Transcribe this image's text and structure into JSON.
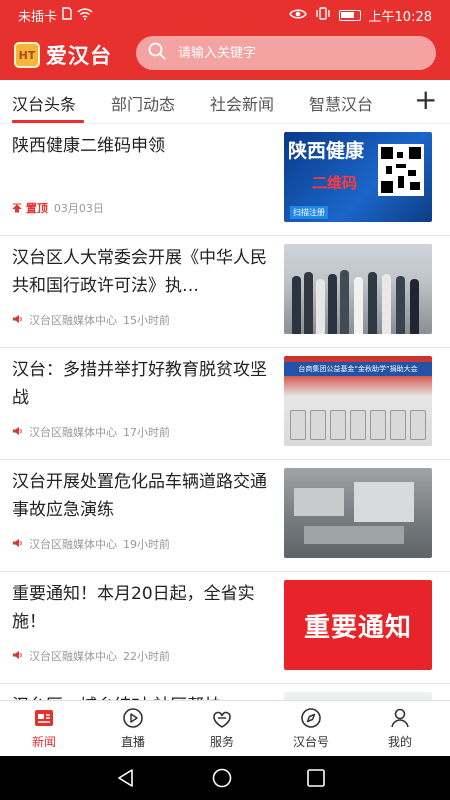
{
  "status": {
    "carrier": "未插卡",
    "time": "上午10:28",
    "icons": [
      "sim-icon",
      "wifi-icon",
      "eye-icon",
      "vibrate-icon",
      "battery-icon"
    ]
  },
  "header": {
    "logo_text": "爱汉台",
    "logo_badge": "HT",
    "search_placeholder": "请输入关键字"
  },
  "tabs": [
    {
      "label": "汉台头条",
      "active": true
    },
    {
      "label": "部门动态"
    },
    {
      "label": "社会新闻"
    },
    {
      "label": "智慧汉台"
    }
  ],
  "tab_add": "+",
  "news": [
    {
      "title": "陕西健康二维码申领",
      "pin_label": "置顶",
      "date": "03月03日",
      "thumb": {
        "line1": "陕西健康",
        "line2": "二维码",
        "line3": "扫描注册"
      }
    },
    {
      "title": "汉台区人大常委会开展《中华人民共和国行政许可法》执…",
      "source": "汉台区融媒体中心",
      "time": "15小时前"
    },
    {
      "title": "汉台：多措并举打好教育脱贫攻坚战",
      "source": "汉台区融媒体中心",
      "time": "17小时前",
      "thumb": {
        "banner": "台商集团公益基金“金秋助学”捐助大会"
      }
    },
    {
      "title": "汉台开展处置危化品车辆道路交通事故应急演练",
      "source": "汉台区融媒体中心",
      "time": "19小时前"
    },
    {
      "title": "重要通知！本月20日起，全省实施！",
      "source": "汉台区融媒体中心",
      "time": "22小时前",
      "thumb": {
        "text": "重要通知"
      }
    },
    {
      "title": "汉台区：城乡结对 社区帮扶"
    }
  ],
  "bottom_nav": [
    {
      "label": "新闻",
      "icon": "news-icon",
      "active": true
    },
    {
      "label": "直播",
      "icon": "play-icon"
    },
    {
      "label": "服务",
      "icon": "service-icon"
    },
    {
      "label": "汉台号",
      "icon": "compass-icon"
    },
    {
      "label": "我的",
      "icon": "person-icon"
    }
  ],
  "colors": {
    "brand": "#e7312f",
    "muted": "#999999"
  }
}
